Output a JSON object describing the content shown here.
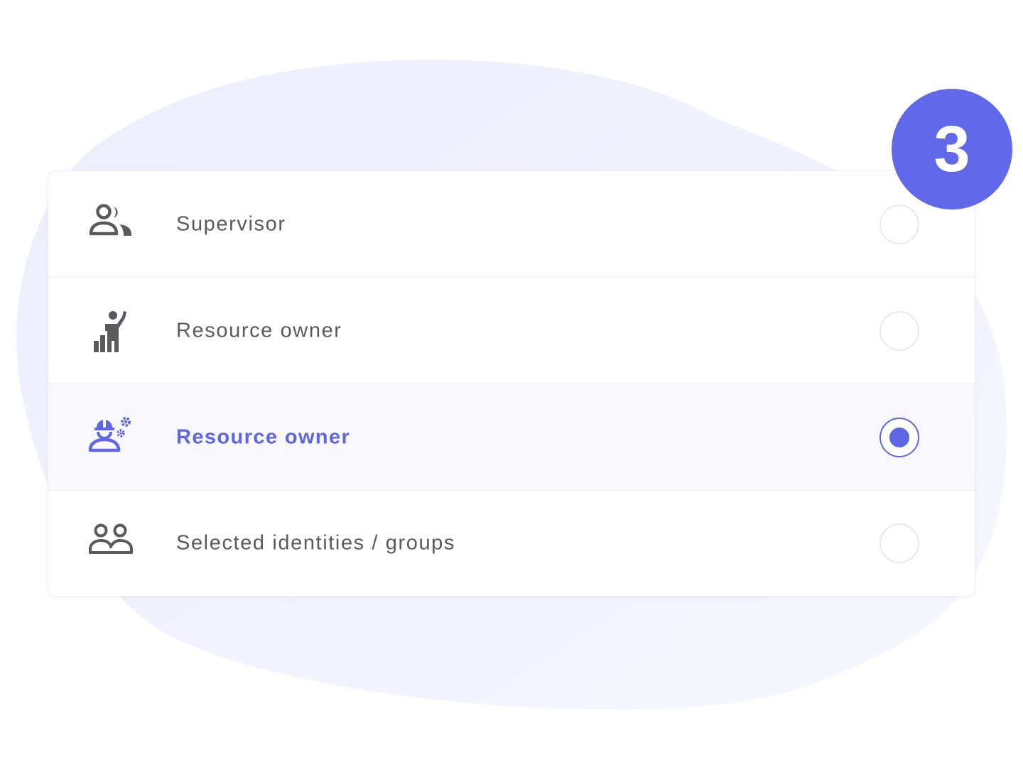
{
  "step_badge": "3",
  "colors": {
    "accent": "#5f66e4",
    "badge": "#6168e9",
    "icon_default": "#5a5a5e",
    "text_default": "#5a5a5e",
    "divider": "#ececf1",
    "blob": "#eef0fd"
  },
  "options": [
    {
      "label": "Supervisor",
      "icon": "supervisor-icon",
      "selected": false
    },
    {
      "label": "Resource owner",
      "icon": "resource-owner-icon",
      "selected": false
    },
    {
      "label": "Resource owner",
      "icon": "technical-owner-icon",
      "selected": true
    },
    {
      "label": "Selected identities / groups",
      "icon": "identities-groups-icon",
      "selected": false
    }
  ]
}
